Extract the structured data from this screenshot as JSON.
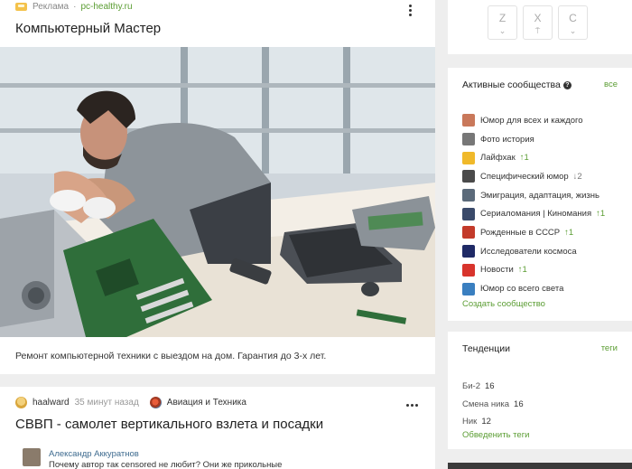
{
  "ad": {
    "label": "Реклама",
    "separator": "·",
    "site": "pc-healthy.ru",
    "title": "Компьютерный Мастер",
    "description": "Ремонт компьютерной техники с выездом на дом. Гарантия до 3-х лет."
  },
  "post": {
    "author": "haalward",
    "time": "35 минут назад",
    "community": "Авиация и Техника",
    "title": "СВВП - самолет вертикального взлета и посадки",
    "comment_author": "Александр Аккуратнов",
    "comment_text": "Почему автор так censored не любит? Они же прикольные"
  },
  "keyboard": {
    "keys": [
      {
        "main": "Z",
        "sub": "⌄"
      },
      {
        "main": "X",
        "sub": "⍑"
      },
      {
        "main": "C",
        "sub": "⌄"
      }
    ]
  },
  "communities": {
    "title": "Активные сообщества",
    "help_icon": "question-icon",
    "all_link": "все",
    "items": [
      {
        "name": "Юмор для всех и каждого",
        "trend": "",
        "color": "#c9785a"
      },
      {
        "name": "Фото история",
        "trend": "",
        "color": "#777777"
      },
      {
        "name": "Лайфхак",
        "trend": "↑1",
        "color": "#f0b92a"
      },
      {
        "name": "Специфический юмор",
        "trend": "↓2",
        "color": "#4a4a4a"
      },
      {
        "name": "Эмиграция, адаптация, жизнь",
        "trend": "",
        "color": "#5b6a7a"
      },
      {
        "name": "Сериаломания | Киномания",
        "trend": "↑1",
        "color": "#3a4a6a"
      },
      {
        "name": "Рожденные в СССР",
        "trend": "↑1",
        "color": "#c33a2a"
      },
      {
        "name": "Исследователи космоса",
        "trend": "",
        "color": "#1f2a66"
      },
      {
        "name": "Новости",
        "trend": "↑1",
        "color": "#d8342c"
      },
      {
        "name": "Юмор со всего света",
        "trend": "",
        "color": "#3a7fc0"
      }
    ],
    "create_link": "Создать сообщество"
  },
  "trends": {
    "title": "Тенденции",
    "tags_link": "теги",
    "items": [
      {
        "name": "Би-2",
        "count": "16"
      },
      {
        "name": "Смена ника",
        "count": "16"
      },
      {
        "name": "Ник",
        "count": "12"
      }
    ],
    "find_link": "Обведенить теги"
  },
  "colors": {
    "accent": "#5b9d33",
    "link_blue": "#3e6b8f"
  }
}
